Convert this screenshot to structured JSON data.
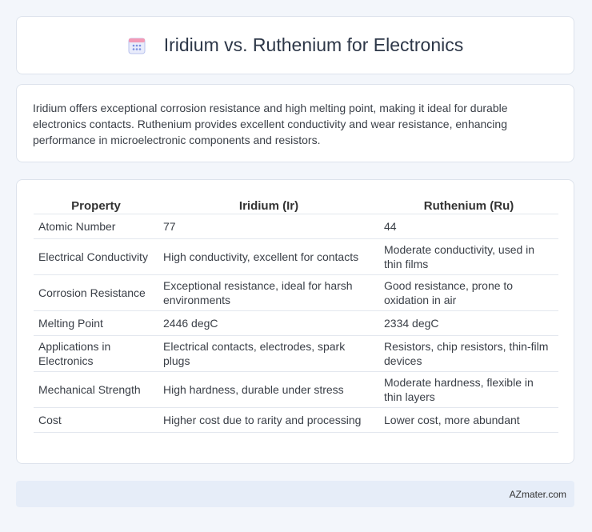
{
  "header": {
    "title": "Iridium vs. Ruthenium for Electronics",
    "icon": "calendar-grid-icon"
  },
  "intro": {
    "text": "Iridium offers exceptional corrosion resistance and high melting point, making it ideal for durable electronics contacts. Ruthenium provides excellent conductivity and wear resistance, enhancing performance in microelectronic components and resistors."
  },
  "table": {
    "headers": [
      "Property",
      "Iridium (Ir)",
      "Ruthenium (Ru)"
    ],
    "rows": [
      [
        "Atomic Number",
        "77",
        "44"
      ],
      [
        "Electrical Conductivity",
        "High conductivity, excellent for contacts",
        "Moderate conductivity, used in thin films"
      ],
      [
        "Corrosion Resistance",
        "Exceptional resistance, ideal for harsh environments",
        "Good resistance, prone to oxidation in air"
      ],
      [
        "Melting Point",
        "2446 degC",
        "2334 degC"
      ],
      [
        "Applications in Electronics",
        "Electrical contacts, electrodes, spark plugs",
        "Resistors, chip resistors, thin-film devices"
      ],
      [
        "Mechanical Strength",
        "High hardness, durable under stress",
        "Moderate hardness, flexible in thin layers"
      ],
      [
        "Cost",
        "Higher cost due to rarity and processing",
        "Lower cost, more abundant"
      ]
    ]
  },
  "footer": {
    "brand": "AZmater.com"
  },
  "colors": {
    "page_bg": "#f3f6fb",
    "card_bg": "#ffffff",
    "footer_bg": "#e6edf8",
    "icon_accent": "#7b8fe0"
  }
}
